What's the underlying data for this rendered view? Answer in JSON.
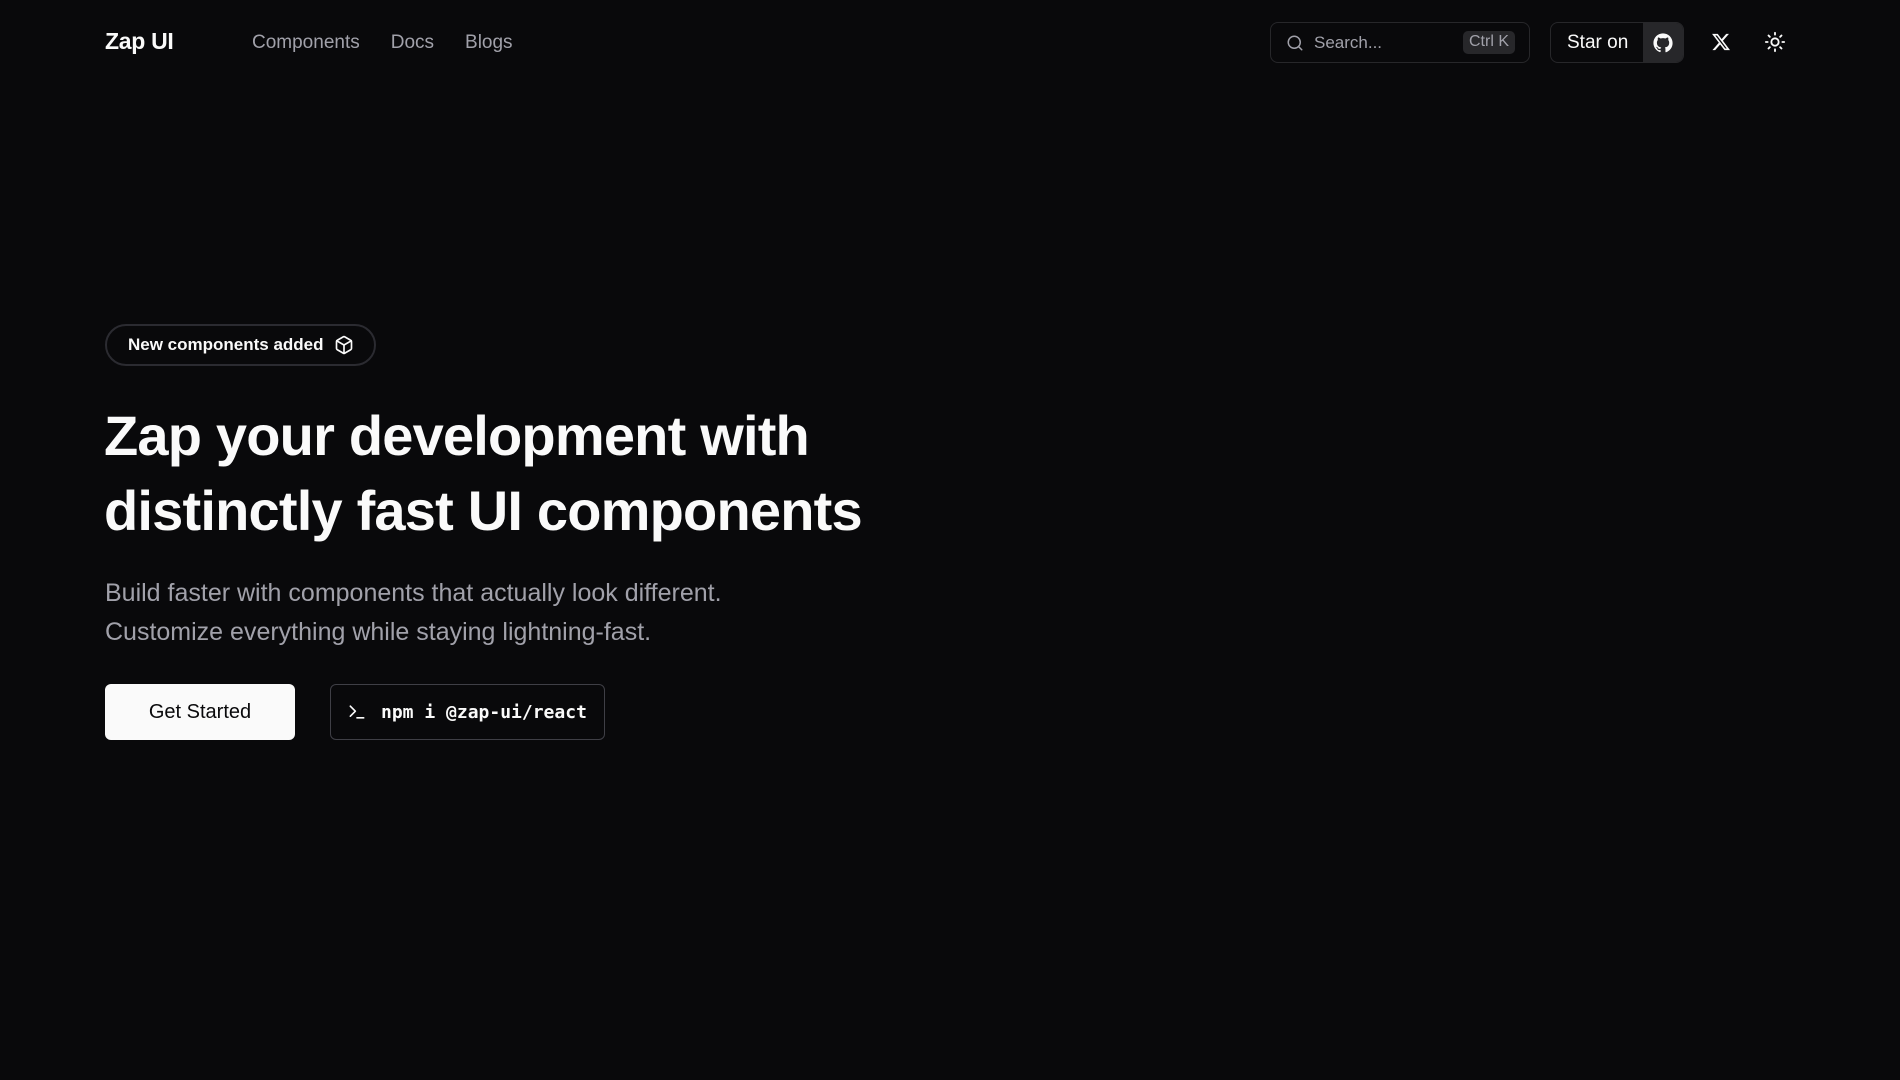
{
  "header": {
    "brand": "Zap UI",
    "nav": [
      {
        "label": "Components"
      },
      {
        "label": "Docs"
      },
      {
        "label": "Blogs"
      }
    ],
    "search": {
      "placeholder": "Search...",
      "shortcut": "Ctrl K",
      "icon": "search-icon"
    },
    "star": {
      "label": "Star on",
      "icon": "github-icon"
    },
    "social_icon": "x-icon",
    "theme_icon": "sun-icon"
  },
  "hero": {
    "badge": {
      "label": "New components added",
      "icon": "box-icon"
    },
    "headline": [
      "Zap your development with",
      "distinctly fast UI components"
    ],
    "subtext": [
      "Build faster with components that actually look different.",
      "Customize everything while staying lightning-fast."
    ],
    "cta_label": "Get Started",
    "install": {
      "prompt_icon": "terminal-icon",
      "command": "npm i @zap-ui/react"
    }
  },
  "colors": {
    "background": "#09090b",
    "foreground": "#fafafa",
    "muted": "#a1a1aa",
    "border": "#27272a",
    "accent": "#38bdf8"
  }
}
